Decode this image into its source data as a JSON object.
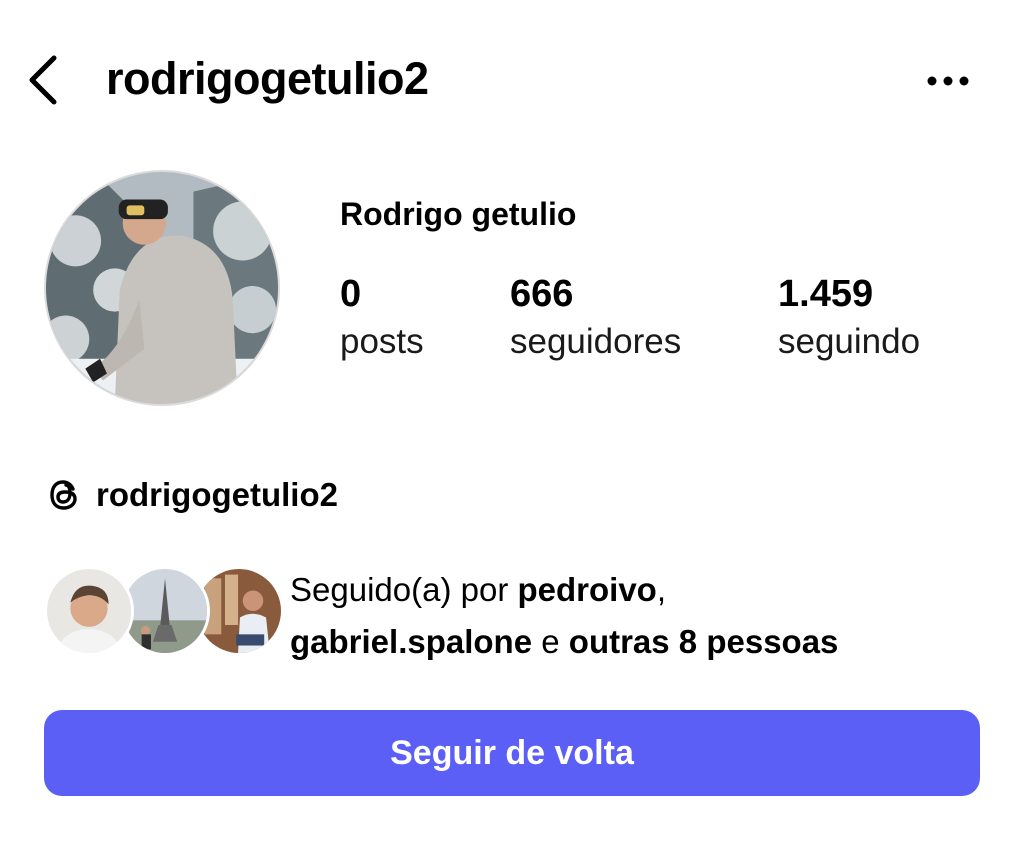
{
  "header": {
    "username": "rodrigogetulio2",
    "back_icon": "chevron-left-icon",
    "more_icon": "more-horizontal-icon"
  },
  "profile": {
    "display_name": "Rodrigo getulio",
    "stats": [
      {
        "value": "0",
        "label": "posts"
      },
      {
        "value": "666",
        "label": "seguidores"
      },
      {
        "value": "1.459",
        "label": "seguindo"
      }
    ]
  },
  "threads": {
    "handle": "rodrigogetulio2",
    "icon": "threads-icon"
  },
  "followed_by": {
    "prefix": "Seguido(a) por ",
    "user1": "pedroivo",
    "separator": ",",
    "user2": "gabriel.spalone",
    "conjunction": " e ",
    "others": "outras 8 pessoas"
  },
  "actions": {
    "follow_back_label": "Seguir de volta"
  },
  "colors": {
    "primary_button": "#5b5ff6",
    "text": "#000000",
    "background": "#ffffff"
  }
}
